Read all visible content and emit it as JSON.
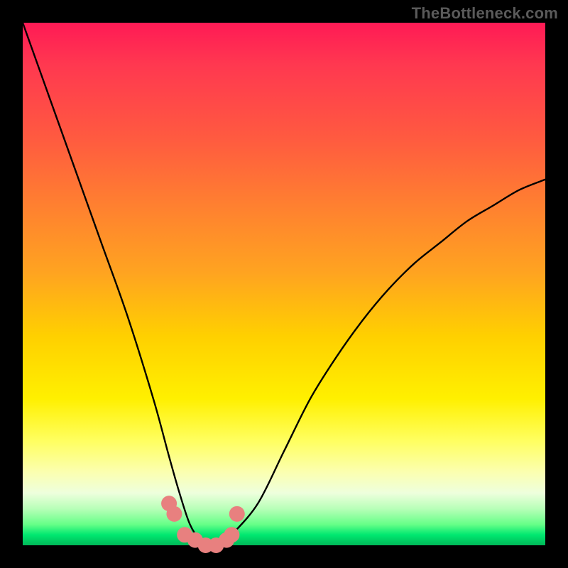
{
  "watermark": "TheBottleneck.com",
  "chart_data": {
    "type": "line",
    "title": "",
    "xlabel": "",
    "ylabel": "",
    "xlim": [
      0,
      100
    ],
    "ylim": [
      0,
      100
    ],
    "description": "Bottleneck curve: percentage mismatch vs component balance. Color gradient background from red (high bottleneck) at top to green (balanced) at bottom. A V-shaped black curve dips to ~0% near x≈35; pink/salmon dotted overlay marks the near-zero optimal band.",
    "series": [
      {
        "name": "bottleneck-curve",
        "x": [
          0,
          5,
          10,
          15,
          20,
          25,
          28,
          30,
          32,
          34,
          36,
          38,
          40,
          45,
          50,
          55,
          60,
          65,
          70,
          75,
          80,
          85,
          90,
          95,
          100
        ],
        "values": [
          100,
          86,
          72,
          58,
          44,
          28,
          17,
          10,
          4,
          1,
          0,
          0,
          2,
          8,
          18,
          28,
          36,
          43,
          49,
          54,
          58,
          62,
          65,
          68,
          70
        ]
      },
      {
        "name": "optimal-band-markers",
        "x": [
          28,
          29,
          31,
          33,
          35,
          37,
          39,
          40,
          41
        ],
        "values": [
          8,
          6,
          2,
          1,
          0,
          0,
          1,
          2,
          6
        ]
      }
    ]
  }
}
